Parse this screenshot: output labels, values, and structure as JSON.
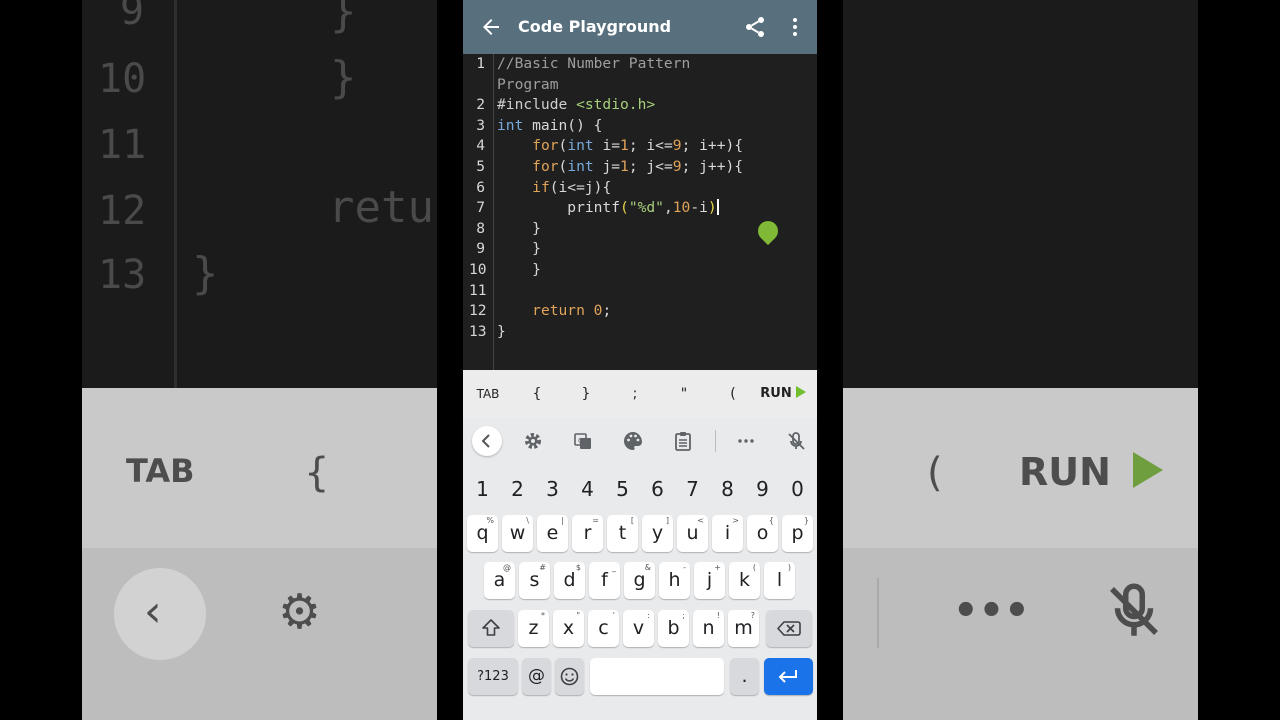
{
  "app": {
    "title": "Code Playground"
  },
  "editor": {
    "lines": [
      {
        "n": "1",
        "tokens": [
          {
            "t": "//Basic Number Pattern",
            "c": "cmt"
          }
        ]
      },
      {
        "n": "",
        "tokens": [
          {
            "t": "Program",
            "c": "cmt"
          }
        ]
      },
      {
        "n": "2",
        "tokens": [
          {
            "t": "#include ",
            "c": "pp"
          },
          {
            "t": "<stdio.h>",
            "c": "inc"
          }
        ]
      },
      {
        "n": "3",
        "tokens": [
          {
            "t": "int",
            "c": "kw"
          },
          {
            "t": " main() {",
            "c": "txt"
          }
        ]
      },
      {
        "n": "4",
        "tokens": [
          {
            "t": "    ",
            "c": "txt"
          },
          {
            "t": "for",
            "c": "ctl"
          },
          {
            "t": "(",
            "c": "txt"
          },
          {
            "t": "int",
            "c": "kw"
          },
          {
            "t": " i=",
            "c": "txt"
          },
          {
            "t": "1",
            "c": "num"
          },
          {
            "t": "; i<=",
            "c": "txt"
          },
          {
            "t": "9",
            "c": "num"
          },
          {
            "t": "; i++){",
            "c": "txt"
          }
        ]
      },
      {
        "n": "5",
        "tokens": [
          {
            "t": "    ",
            "c": "txt"
          },
          {
            "t": "for",
            "c": "ctl"
          },
          {
            "t": "(",
            "c": "txt"
          },
          {
            "t": "int",
            "c": "kw"
          },
          {
            "t": " j=",
            "c": "txt"
          },
          {
            "t": "1",
            "c": "num"
          },
          {
            "t": "; j<=",
            "c": "txt"
          },
          {
            "t": "9",
            "c": "num"
          },
          {
            "t": "; j++){",
            "c": "txt"
          }
        ]
      },
      {
        "n": "6",
        "tokens": [
          {
            "t": "    ",
            "c": "txt"
          },
          {
            "t": "if",
            "c": "ctl"
          },
          {
            "t": "(i<=j){",
            "c": "txt"
          }
        ]
      },
      {
        "n": "7",
        "tokens": [
          {
            "t": "        printf",
            "c": "txt"
          },
          {
            "t": "(",
            "c": "paren"
          },
          {
            "t": "\"%d\"",
            "c": "str"
          },
          {
            "t": ",",
            "c": "txt"
          },
          {
            "t": "10",
            "c": "num"
          },
          {
            "t": "-i",
            "c": "txt"
          },
          {
            "t": ")",
            "c": "paren"
          },
          {
            "t": "",
            "c": "caret"
          }
        ]
      },
      {
        "n": "8",
        "tokens": [
          {
            "t": "    }",
            "c": "txt"
          }
        ]
      },
      {
        "n": "9",
        "tokens": [
          {
            "t": "    }",
            "c": "txt"
          }
        ]
      },
      {
        "n": "10",
        "tokens": [
          {
            "t": "    }",
            "c": "txt"
          }
        ]
      },
      {
        "n": "11",
        "tokens": []
      },
      {
        "n": "12",
        "tokens": [
          {
            "t": "    ",
            "c": "txt"
          },
          {
            "t": "return",
            "c": "ctl"
          },
          {
            "t": " ",
            "c": "txt"
          },
          {
            "t": "0",
            "c": "num"
          },
          {
            "t": ";",
            "c": "txt"
          }
        ]
      },
      {
        "n": "13",
        "tokens": [
          {
            "t": "}",
            "c": "txt"
          }
        ]
      }
    ]
  },
  "symbol_bar": {
    "tab": "TAB",
    "symbols": [
      "{",
      "}",
      ";",
      "\"",
      "("
    ],
    "run": "RUN"
  },
  "keyboard": {
    "toolbar_icons": [
      "back-chevron-icon",
      "gear-icon",
      "translate-icon",
      "palette-icon",
      "clipboard-icon",
      "more-icon",
      "mic-off-icon"
    ],
    "number_row": [
      "1",
      "2",
      "3",
      "4",
      "5",
      "6",
      "7",
      "8",
      "9",
      "0"
    ],
    "row1": [
      {
        "k": "q",
        "s": "%"
      },
      {
        "k": "w",
        "s": "\\"
      },
      {
        "k": "e",
        "s": "|"
      },
      {
        "k": "r",
        "s": "="
      },
      {
        "k": "t",
        "s": "["
      },
      {
        "k": "y",
        "s": "]"
      },
      {
        "k": "u",
        "s": "<"
      },
      {
        "k": "i",
        "s": ">"
      },
      {
        "k": "o",
        "s": "{"
      },
      {
        "k": "p",
        "s": "}"
      }
    ],
    "row2": [
      {
        "k": "a",
        "s": "@"
      },
      {
        "k": "s",
        "s": "#"
      },
      {
        "k": "d",
        "s": "$"
      },
      {
        "k": "f",
        "s": "_"
      },
      {
        "k": "g",
        "s": "&"
      },
      {
        "k": "h",
        "s": "-"
      },
      {
        "k": "j",
        "s": "+"
      },
      {
        "k": "k",
        "s": "("
      },
      {
        "k": "l",
        "s": ")"
      }
    ],
    "row3": [
      {
        "k": "z",
        "s": "*"
      },
      {
        "k": "x",
        "s": "\""
      },
      {
        "k": "c",
        "s": "'"
      },
      {
        "k": "v",
        "s": ":"
      },
      {
        "k": "b",
        "s": ";"
      },
      {
        "k": "n",
        "s": "!"
      },
      {
        "k": "m",
        "s": "?"
      }
    ],
    "symbols_key": "?123",
    "at_key": "@",
    "period_key": "."
  },
  "background": {
    "line_numbers": [
      "9",
      "10",
      "11",
      "12",
      "13"
    ],
    "code_fragments": [
      "}",
      "}",
      "retu",
      "}"
    ],
    "left_keys": [
      "TAB",
      "{"
    ],
    "right_keys": [
      "(",
      "RUN"
    ]
  },
  "colors": {
    "appbar": "#58707d",
    "editor_bg": "#1f1f1f",
    "run_green": "#6fbf2f",
    "enter_blue": "#1a73e8"
  }
}
